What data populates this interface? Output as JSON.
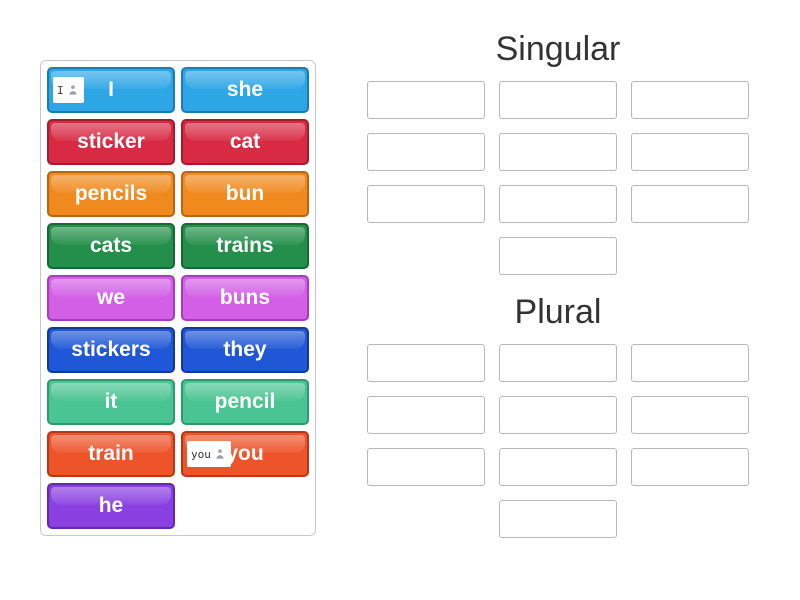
{
  "colors": {
    "skyblue": {
      "fill": "#2ea6e6",
      "edge": "#1b7bb5"
    },
    "crimson": {
      "fill": "#d82a43",
      "edge": "#a31b30"
    },
    "orange": {
      "fill": "#f08a1e",
      "edge": "#b86610"
    },
    "green": {
      "fill": "#238f4a",
      "edge": "#156a33"
    },
    "magenta": {
      "fill": "#d25fe6",
      "edge": "#a63bbb"
    },
    "royalblue": {
      "fill": "#1f57d6",
      "edge": "#123a99"
    },
    "teal": {
      "fill": "#49c492",
      "edge": "#2f9a6e"
    },
    "redorange": {
      "fill": "#ee542a",
      "edge": "#b93716"
    },
    "violet": {
      "fill": "#8a3fe0",
      "edge": "#642aad"
    }
  },
  "tiles": [
    {
      "id": "tile-i",
      "label": "I",
      "color": "skyblue",
      "badge_text": "I"
    },
    {
      "id": "tile-she",
      "label": "she",
      "color": "skyblue",
      "badge_text": null
    },
    {
      "id": "tile-sticker",
      "label": "sticker",
      "color": "crimson",
      "badge_text": null
    },
    {
      "id": "tile-cat",
      "label": "cat",
      "color": "crimson",
      "badge_text": null
    },
    {
      "id": "tile-pencils",
      "label": "pencils",
      "color": "orange",
      "badge_text": null
    },
    {
      "id": "tile-bun",
      "label": "bun",
      "color": "orange",
      "badge_text": null
    },
    {
      "id": "tile-cats",
      "label": "cats",
      "color": "green",
      "badge_text": null
    },
    {
      "id": "tile-trains",
      "label": "trains",
      "color": "green",
      "badge_text": null
    },
    {
      "id": "tile-we",
      "label": "we",
      "color": "magenta",
      "badge_text": null
    },
    {
      "id": "tile-buns",
      "label": "buns",
      "color": "magenta",
      "badge_text": null
    },
    {
      "id": "tile-stickers",
      "label": "stickers",
      "color": "royalblue",
      "badge_text": null
    },
    {
      "id": "tile-they",
      "label": "they",
      "color": "royalblue",
      "badge_text": null
    },
    {
      "id": "tile-it",
      "label": "it",
      "color": "teal",
      "badge_text": null
    },
    {
      "id": "tile-pencil",
      "label": "pencil",
      "color": "teal",
      "badge_text": null
    },
    {
      "id": "tile-train",
      "label": "train",
      "color": "redorange",
      "badge_text": null
    },
    {
      "id": "tile-you",
      "label": "you",
      "color": "redorange",
      "badge_text": "you"
    },
    {
      "id": "tile-he",
      "label": "he",
      "color": "violet",
      "badge_text": null
    }
  ],
  "groups": [
    {
      "id": "group-singular",
      "title": "Singular",
      "slot_count": 10
    },
    {
      "id": "group-plural",
      "title": "Plural",
      "slot_count": 10
    }
  ]
}
